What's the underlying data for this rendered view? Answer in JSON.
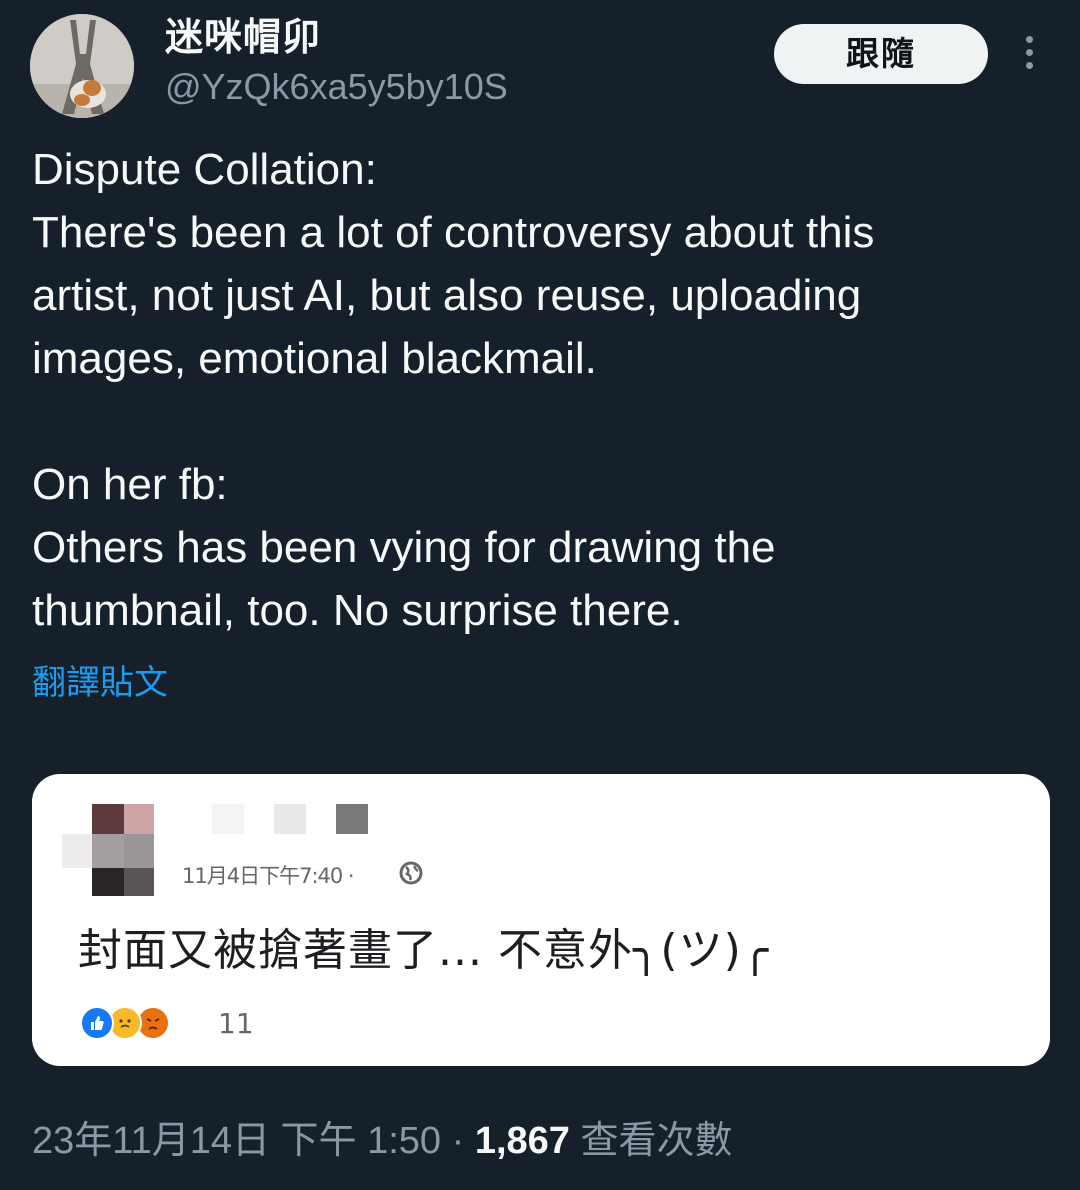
{
  "author": {
    "display_name": "迷咪帽卯",
    "handle": "@YzQk6xa5y5by10S",
    "avatar_icon": "eiffel-tower-cat-avatar"
  },
  "follow_label": "跟隨",
  "more_icon": "more-vertical-icon",
  "tweet": {
    "lines": [
      "Dispute Collation:",
      "There's been a lot of controversy about this",
      "artist, not just AI, but also reuse, uploading",
      "images, emotional blackmail.",
      "",
      "On her fb:",
      "Others has been vying for drawing the",
      "thumbnail, too. No surprise there."
    ]
  },
  "translate_label": "翻譯貼文",
  "embedded_fb_post": {
    "timestamp": "11月4日下午7:40 ·",
    "text": "封面又被搶著畫了... 不意外╮(ツ)╭",
    "reaction_count": "11",
    "reactions": [
      "like",
      "care",
      "angry"
    ]
  },
  "meta": {
    "date_time": "23年11月14日 下午 1:50",
    "separator": "·",
    "views": "1,867",
    "views_label": "查看次數"
  },
  "colors": {
    "background": "#15202b",
    "text": "#f7f9f9",
    "secondary": "#8b98a5",
    "link": "#1d9bf0"
  }
}
